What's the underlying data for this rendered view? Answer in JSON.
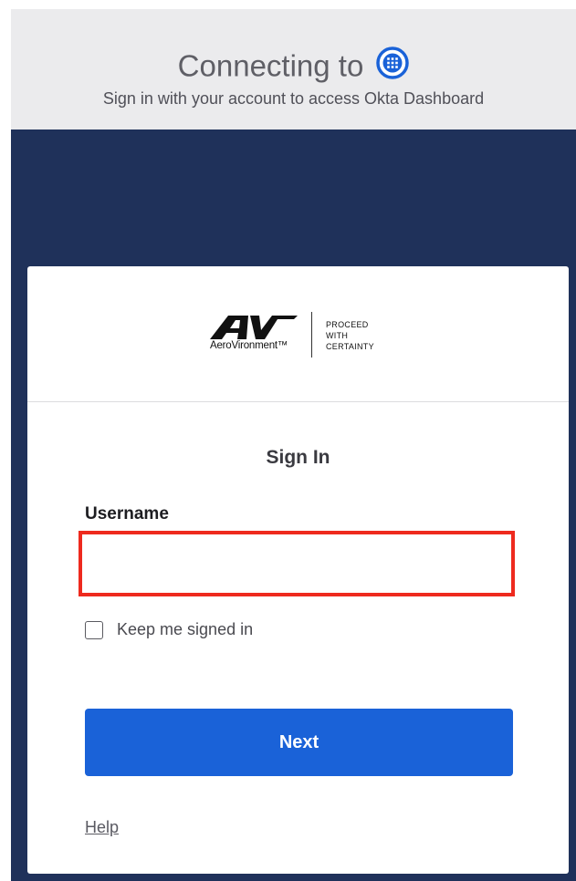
{
  "header": {
    "connecting_text": "Connecting to",
    "subtitle": "Sign in with your account to access Okta Dashboard",
    "app_icon": "okta-dashboard-icon"
  },
  "logo": {
    "mark_text": "AV",
    "company_name": "AeroVironment™",
    "tagline_line1": "PROCEED",
    "tagline_line2": "WITH",
    "tagline_line3": "CERTAINTY"
  },
  "form": {
    "title": "Sign In",
    "username_label": "Username",
    "username_value": "",
    "username_placeholder": "",
    "keep_signed_in_label": "Keep me signed in",
    "keep_signed_in_checked": false,
    "next_label": "Next",
    "help_label": "Help"
  },
  "colors": {
    "banner_bg": "#ebebed",
    "navy_bg": "#1f315a",
    "primary_button": "#1a62d8",
    "highlight_border": "#ee2a1e",
    "icon_blue": "#1a62d8"
  }
}
